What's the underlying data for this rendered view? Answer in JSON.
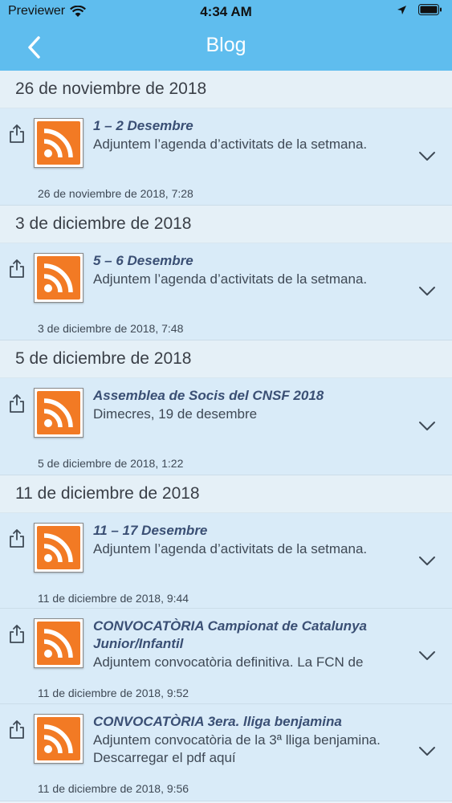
{
  "status": {
    "carrier": "Previewer",
    "time": "4:34 AM"
  },
  "nav": {
    "title": "Blog"
  },
  "sections": [
    {
      "date": "26 de noviembre de 2018",
      "items": [
        {
          "title": "1 – 2 Desembre",
          "desc": "Adjuntem l’agenda d’activitats de la setmana.",
          "stamp": "26 de noviembre de 2018, 7:28"
        }
      ]
    },
    {
      "date": "3 de diciembre de 2018",
      "items": [
        {
          "title": "5 – 6 Desembre",
          "desc": "Adjuntem l’agenda d’activitats de la setmana.",
          "stamp": "3 de diciembre de 2018, 7:48"
        }
      ]
    },
    {
      "date": "5 de diciembre de 2018",
      "items": [
        {
          "title": "Assemblea de Socis del CNSF 2018",
          "desc": "Dimecres, 19 de desembre",
          "stamp": "5 de diciembre de 2018, 1:22"
        }
      ]
    },
    {
      "date": "11 de diciembre de 2018",
      "items": [
        {
          "title": "11 – 17 Desembre",
          "desc": "Adjuntem l’agenda d’activitats de la setmana.",
          "stamp": "11 de diciembre de 2018, 9:44"
        },
        {
          "title": "CONVOCATÒRIA Campionat de Catalunya Junior/Infantil",
          "desc": "Adjuntem convocatòria definitiva. La FCN de",
          "stamp": "11 de diciembre de 2018, 9:52"
        },
        {
          "title": "CONVOCATÒRIA 3era. lliga benjamina",
          "desc": "Adjuntem convocatòria de la 3ª lliga benjamina. Descarregar el pdf aquí",
          "stamp": "11 de diciembre de 2018, 9:56"
        }
      ]
    }
  ]
}
